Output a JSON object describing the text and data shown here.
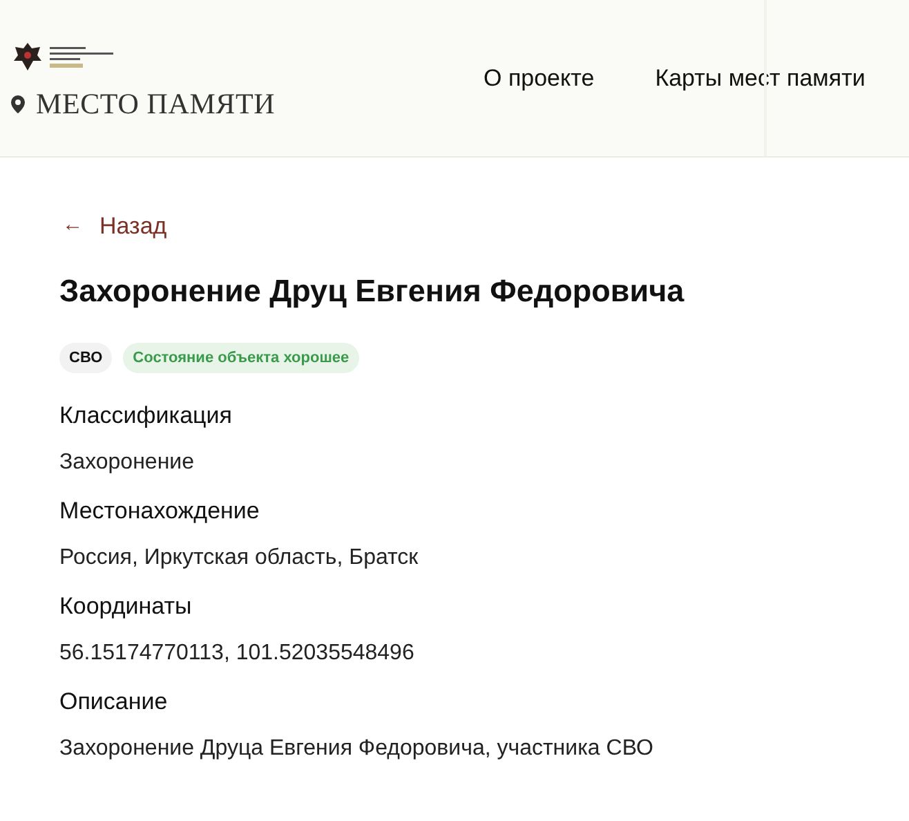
{
  "header": {
    "site_name": "МЕСТО ПАМЯТИ",
    "nav": [
      {
        "label": "О проекте"
      },
      {
        "label": "Карты мест памяти"
      }
    ]
  },
  "back_link": {
    "icon": "←",
    "label": "Назад"
  },
  "title": "Захоронение Друц Евгения Федоровича",
  "tags": [
    {
      "label": "СВО",
      "kind": "neutral"
    },
    {
      "label": "Состояние объекта хорошее",
      "kind": "success"
    }
  ],
  "fields": [
    {
      "label": "Классификация",
      "value": "Захоронение"
    },
    {
      "label": "Местонахождение",
      "value": "Россия, Иркутская область, Братск"
    },
    {
      "label": "Координаты",
      "value": "56.15174770113, 101.52035548496"
    },
    {
      "label": "Описание",
      "value": "Захоронение Друца Евгения Федоровича, участника СВО"
    }
  ]
}
